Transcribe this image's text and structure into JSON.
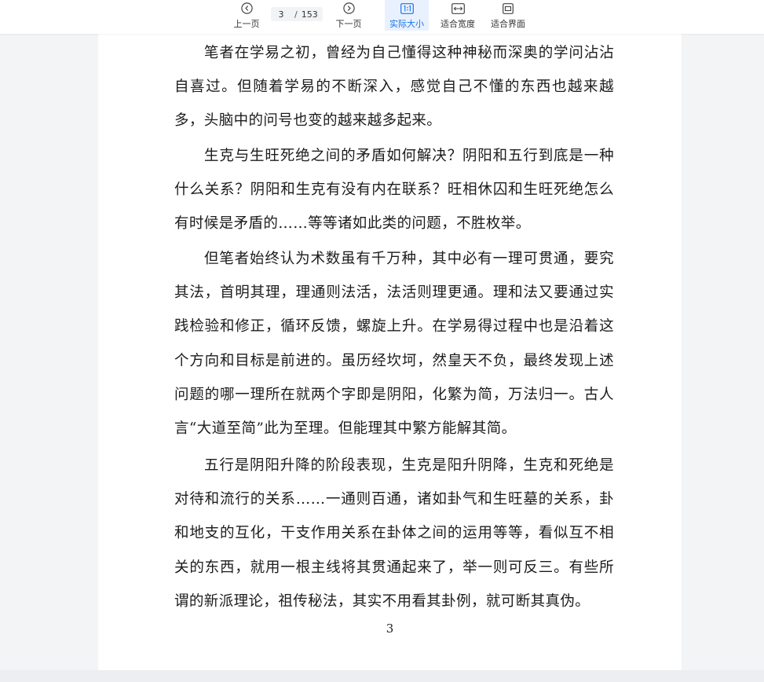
{
  "toolbar": {
    "prev_label": "上一页",
    "next_label": "下一页",
    "current_page": "3",
    "separator": "/",
    "total_pages": "153",
    "actual_size_label": "实际大小",
    "fit_width_label": "适合宽度",
    "fit_page_label": "适合界面",
    "accent_color": "#1a73e8",
    "icons": {
      "prev": "chevron-left-circle-icon",
      "next": "chevron-right-circle-icon",
      "actual": "one-to-one-icon",
      "fit_width": "fit-width-icon",
      "fit_page": "fit-page-icon"
    }
  },
  "document": {
    "paragraphs": [
      "笔者在学易之初，曾经为自己懂得这种神秘而深奥的学问沾沾自喜过。但随着学易的不断深入，感觉自己不懂的东西也越来越多，头脑中的问号也变的越来越多起来。",
      "生克与生旺死绝之间的矛盾如何解决？阴阳和五行到底是一种什么关系？阴阳和生克有没有内在联系？旺相休囚和生旺死绝怎么有时候是矛盾的……等等诸如此类的问题，不胜枚举。",
      "但笔者始终认为术数虽有千万种，其中必有一理可贯通，要究其法，首明其理，理通则法活，法活则理更通。理和法又要通过实践检验和修正，循环反馈，螺旋上升。在学易得过程中也是沿着这个方向和目标是前进的。虽历经坎坷，然皇天不负，最终发现上述问题的哪一理所在就两个字即是阴阳，化繁为简，万法归一。古人言“大道至简”此为至理。但能理其中繁方能解其简。",
      "五行是阴阳升降的阶段表现，生克是阳升阴降，生克和死绝是对待和流行的关系……一通则百通，诸如卦气和生旺墓的关系，卦和地支的互化，干支作用关系在卦体之间的运用等等，看似互不相关的东西，就用一根主线将其贯通起来了，举一则可反三。有些所谓的新派理论，祖传秘法，其实不用看其卦例，就可断其真伪。"
    ],
    "page_number": "3"
  }
}
